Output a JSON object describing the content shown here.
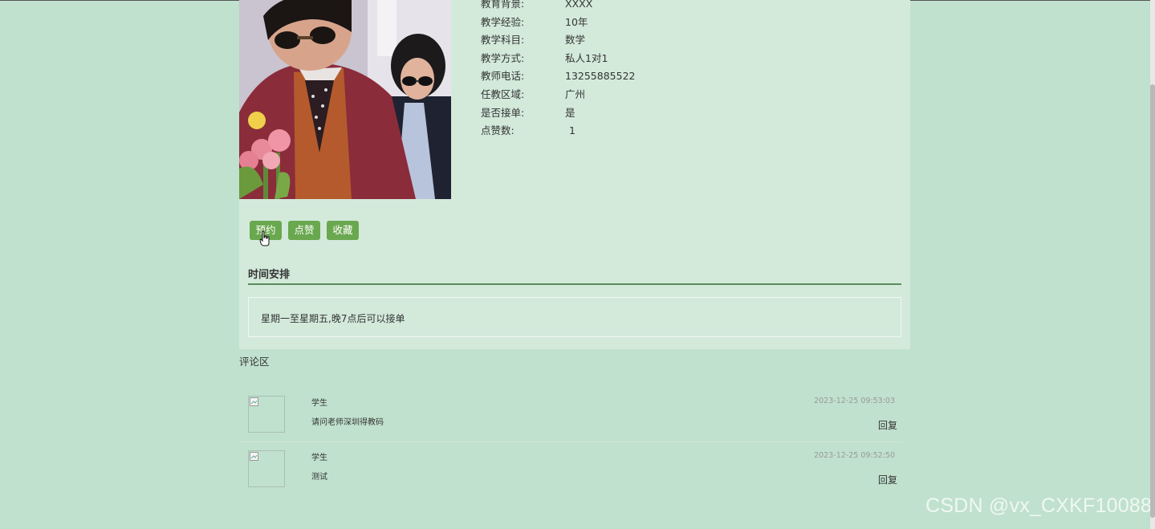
{
  "teacher_info": [
    {
      "label": "教育背景:",
      "value": "XXXX"
    },
    {
      "label": "教学经验:",
      "value": "10年"
    },
    {
      "label": "教学科目:",
      "value": "数学"
    },
    {
      "label": "教学方式:",
      "value": "私人1对1"
    },
    {
      "label": "教师电话:",
      "value": "13255885522"
    },
    {
      "label": "任教区域:",
      "value": "广州"
    },
    {
      "label": "是否接单:",
      "value": "是"
    },
    {
      "label": "点赞数:",
      "value": "1"
    }
  ],
  "actions": {
    "book_label": "预约",
    "like_label": "点赞",
    "favorite_label": "收藏",
    "button_color": "#6aa84f"
  },
  "schedule": {
    "title": "时间安排",
    "text": "星期一至星期五,晚7点后可以接单"
  },
  "comments": {
    "title": "评论区",
    "items": [
      {
        "author": "学生",
        "text": "请问老师深圳得教码",
        "time": "2023-12-25 09:53:03",
        "reply_label": "回复"
      },
      {
        "author": "学生",
        "text": "测试",
        "time": "2023-12-25 09:52:50",
        "reply_label": "回复"
      }
    ]
  },
  "watermark": "CSDN @vx_CXKF10088",
  "colors": {
    "page_background": "#c0e1cd",
    "panel_background": "#d3eadb",
    "accent_green": "#6aa84f"
  }
}
